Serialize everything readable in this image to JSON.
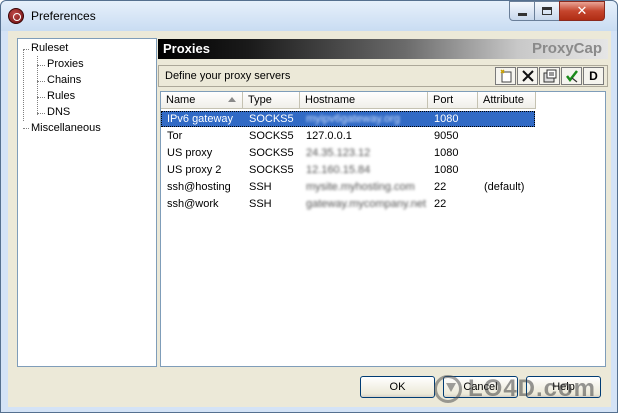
{
  "window": {
    "title": "Preferences"
  },
  "tree": {
    "items": [
      {
        "label": "Ruleset"
      },
      {
        "label": "Proxies"
      },
      {
        "label": "Chains"
      },
      {
        "label": "Rules"
      },
      {
        "label": "DNS"
      },
      {
        "label": "Miscellaneous"
      }
    ]
  },
  "header": {
    "title": "Proxies",
    "brand": "ProxyCap"
  },
  "toolbar": {
    "label": "Define your proxy servers",
    "buttons": [
      {
        "icon": "new-icon"
      },
      {
        "icon": "delete-icon"
      },
      {
        "icon": "properties-icon"
      },
      {
        "icon": "check-icon"
      },
      {
        "icon": "d-icon",
        "label": "D"
      }
    ]
  },
  "table": {
    "columns": [
      "Name",
      "Type",
      "Hostname",
      "Port",
      "Attribute"
    ],
    "rows": [
      {
        "name": "IPv6 gateway",
        "type": "SOCKS5",
        "hostname": "myipv6gateway.org",
        "port": "1080",
        "attribute": ""
      },
      {
        "name": "Tor",
        "type": "SOCKS5",
        "hostname": "127.0.0.1",
        "port": "9050",
        "attribute": ""
      },
      {
        "name": "US proxy",
        "type": "SOCKS5",
        "hostname": "24.35.123.12",
        "port": "1080",
        "attribute": ""
      },
      {
        "name": "US proxy 2",
        "type": "SOCKS5",
        "hostname": "12.160.15.84",
        "port": "1080",
        "attribute": ""
      },
      {
        "name": "ssh@hosting",
        "type": "SSH",
        "hostname": "mysite.myhosting.com",
        "port": "22",
        "attribute": "(default)"
      },
      {
        "name": "ssh@work",
        "type": "SSH",
        "hostname": "gateway.mycompany.net",
        "port": "22",
        "attribute": ""
      }
    ]
  },
  "buttons": {
    "ok": "OK",
    "cancel": "Cancel",
    "help": "Help"
  },
  "watermark": {
    "text": "LO4D.com"
  }
}
